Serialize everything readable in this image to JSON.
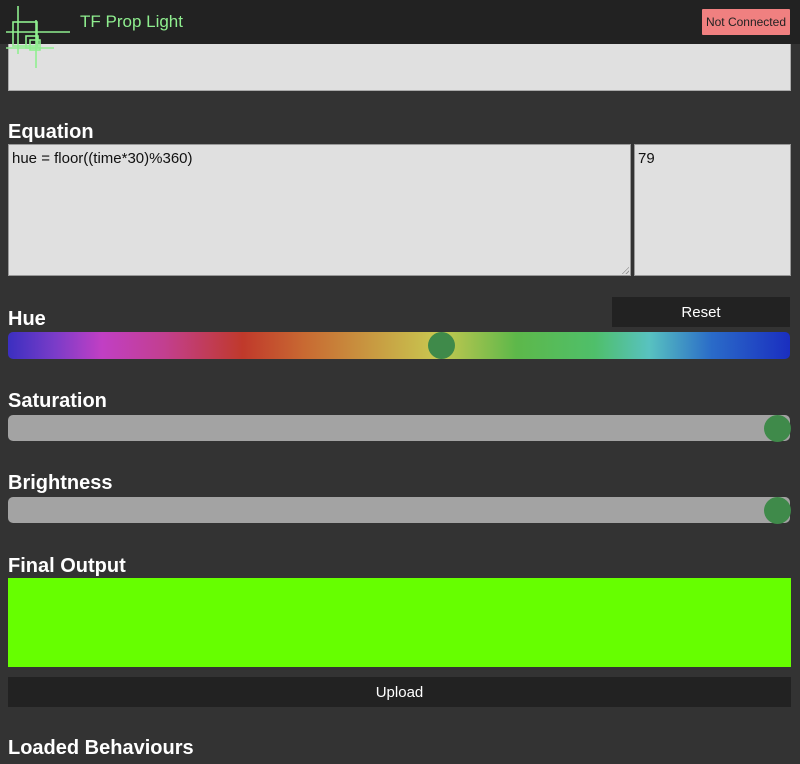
{
  "app": {
    "title": "TF Prop Light",
    "connection_status": "Not Connected",
    "connection_color": "#f08080",
    "accent": "#8fee8f"
  },
  "equation": {
    "heading": "Equation",
    "code": "hue = floor((time*30)%360)",
    "result": "79"
  },
  "hue": {
    "heading": "Hue",
    "reset_label": "Reset",
    "level": 0.555
  },
  "saturation": {
    "heading": "Saturation",
    "level": 1.0
  },
  "brightness": {
    "heading": "Brightness",
    "level": 1.0
  },
  "output": {
    "heading": "Final Output",
    "color": "#66ff00",
    "upload_label": "Upload"
  },
  "behaviours": {
    "heading": "Loaded Behaviours"
  },
  "icons": {
    "logo": "crosshair-squares-logo-icon"
  }
}
